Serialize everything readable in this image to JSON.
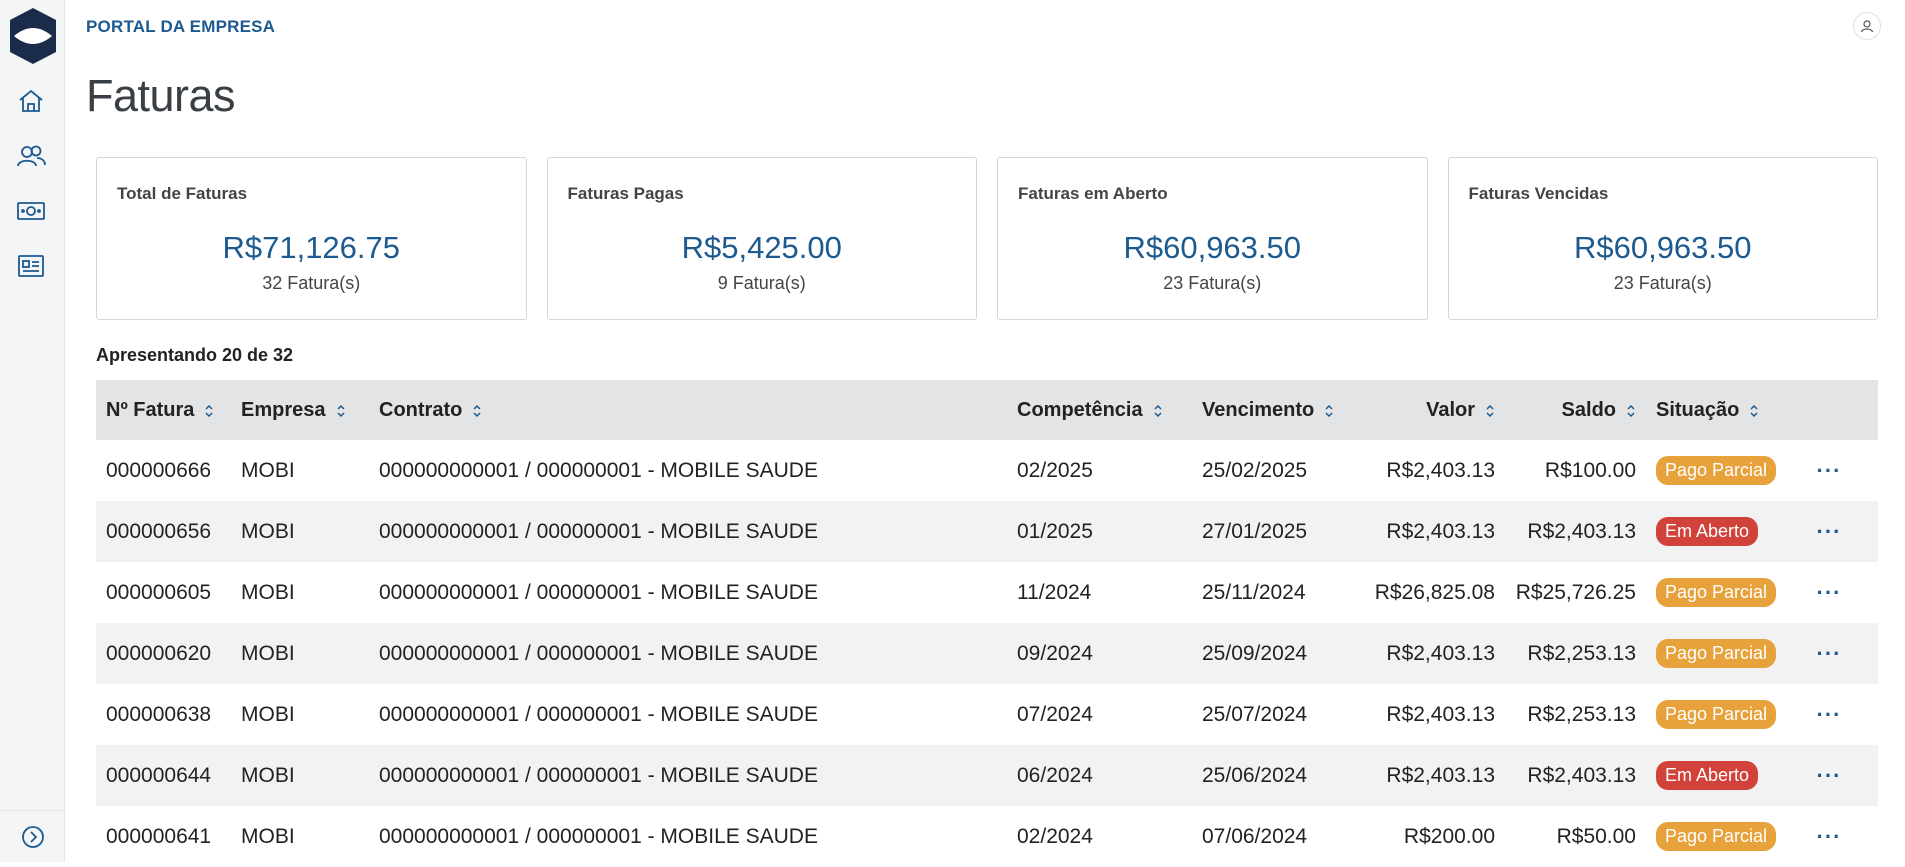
{
  "app": {
    "brand": "PORTAL DA EMPRESA"
  },
  "page": {
    "title": "Faturas"
  },
  "cards": [
    {
      "label": "Total de Faturas",
      "value": "R$71,126.75",
      "count": "32 Fatura(s)"
    },
    {
      "label": "Faturas Pagas",
      "value": "R$5,425.00",
      "count": "9 Fatura(s)"
    },
    {
      "label": "Faturas em Aberto",
      "value": "R$60,963.50",
      "count": "23 Fatura(s)"
    },
    {
      "label": "Faturas Vencidas",
      "value": "R$60,963.50",
      "count": "23 Fatura(s)"
    }
  ],
  "showing": "Apresentando 20 de 32",
  "table": {
    "headers": [
      "Nº Fatura",
      "Empresa",
      "Contrato",
      "Competência",
      "Vencimento",
      "Valor",
      "Saldo",
      "Situação"
    ],
    "rows": [
      {
        "numero": "000000666",
        "empresa": "MOBI",
        "contrato": "000000000001 / 000000001 - MOBILE SAUDE",
        "competencia": "02/2025",
        "vencimento": "25/02/2025",
        "valor": "R$2,403.13",
        "saldo": "R$100.00",
        "situacao": "Pago Parcial",
        "more": "···"
      },
      {
        "numero": "000000656",
        "empresa": "MOBI",
        "contrato": "000000000001 / 000000001 - MOBILE SAUDE",
        "competencia": "01/2025",
        "vencimento": "27/01/2025",
        "valor": "R$2,403.13",
        "saldo": "R$2,403.13",
        "situacao": "Em Aberto",
        "more": "···"
      },
      {
        "numero": "000000605",
        "empresa": "MOBI",
        "contrato": "000000000001 / 000000001 - MOBILE SAUDE",
        "competencia": "11/2024",
        "vencimento": "25/11/2024",
        "valor": "R$26,825.08",
        "saldo": "R$25,726.25",
        "situacao": "Pago Parcial",
        "more": "···"
      },
      {
        "numero": "000000620",
        "empresa": "MOBI",
        "contrato": "000000000001 / 000000001 - MOBILE SAUDE",
        "competencia": "09/2024",
        "vencimento": "25/09/2024",
        "valor": "R$2,403.13",
        "saldo": "R$2,253.13",
        "situacao": "Pago Parcial",
        "more": "···"
      },
      {
        "numero": "000000638",
        "empresa": "MOBI",
        "contrato": "000000000001 / 000000001 - MOBILE SAUDE",
        "competencia": "07/2024",
        "vencimento": "25/07/2024",
        "valor": "R$2,403.13",
        "saldo": "R$2,253.13",
        "situacao": "Pago Parcial",
        "more": "···"
      },
      {
        "numero": "000000644",
        "empresa": "MOBI",
        "contrato": "000000000001 / 000000001 - MOBILE SAUDE",
        "competencia": "06/2024",
        "vencimento": "25/06/2024",
        "valor": "R$2,403.13",
        "saldo": "R$2,403.13",
        "situacao": "Em Aberto",
        "more": "···"
      },
      {
        "numero": "000000641",
        "empresa": "MOBI",
        "contrato": "000000000001 / 000000001 - MOBILE SAUDE",
        "competencia": "02/2024",
        "vencimento": "07/06/2024",
        "valor": "R$200.00",
        "saldo": "R$50.00",
        "situacao": "Pago Parcial",
        "more": "···"
      }
    ]
  },
  "sidebar": {
    "items": [
      {
        "icon": "home-icon"
      },
      {
        "icon": "users-icon"
      },
      {
        "icon": "money-icon"
      },
      {
        "icon": "id-card-icon"
      }
    ],
    "expand_icon": "chevron-right-circle-icon"
  },
  "colors": {
    "brand": "#1c5a8f",
    "partial": "#e8a23c",
    "open": "#d1423a"
  }
}
